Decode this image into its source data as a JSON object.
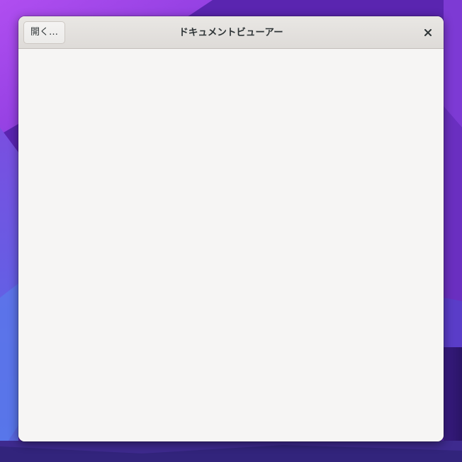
{
  "window": {
    "title": "ドキュメントビューアー"
  },
  "headerbar": {
    "open_label": "開く…",
    "close_icon": "close-icon"
  },
  "colors": {
    "headerbar_bg": "#e1dedb",
    "content_bg": "#f6f5f4",
    "title_text": "#2e3436"
  }
}
